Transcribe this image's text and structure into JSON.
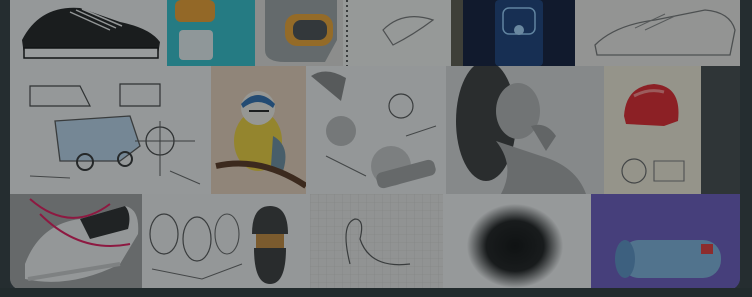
{
  "gallery": {
    "colors": {
      "backdrop": "#374046",
      "overlay": "rgba(20,26,28,0.42)"
    },
    "row1": [
      {
        "name": "sneaker-line-drawing-thumb"
      },
      {
        "name": "product-render-thumb"
      },
      {
        "name": "sketchbook-dove-thumb"
      },
      {
        "name": "phone-product-thumb"
      },
      {
        "name": "shoe-pencil-sketch-thumb"
      }
    ],
    "row2": [
      {
        "name": "vehicle-concept-sketch-thumb"
      },
      {
        "name": "blue-tit-bird-thumb"
      },
      {
        "name": "tool-sketches-thumb"
      },
      {
        "name": "woman-portrait-thumb"
      },
      {
        "name": "red-helmet-sketch-thumb"
      }
    ],
    "row3": [
      {
        "name": "red-sneaker-render-thumb"
      },
      {
        "name": "capsule-character-sketch-thumb"
      },
      {
        "name": "swan-grid-sketch-thumb"
      },
      {
        "name": "dark-blur-circle-thumb"
      },
      {
        "name": "blue-speaker-render-thumb"
      }
    ]
  }
}
